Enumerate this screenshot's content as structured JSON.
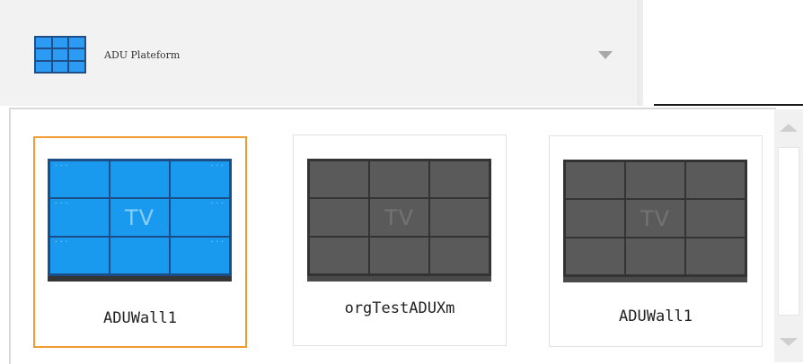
{
  "header": {
    "platform_label": "ADU Plateform",
    "platform_icon": "video-wall-grid-icon",
    "dropdown_icon": "chevron-down-icon"
  },
  "walls": [
    {
      "name": "ADUWall1",
      "screen_text": "TV",
      "selected": true,
      "status": "online"
    },
    {
      "name": "orgTestADUXm",
      "screen_text": "TV",
      "selected": false,
      "status": "offline"
    },
    {
      "name": "ADUWall1",
      "screen_text": "TV",
      "selected": false,
      "status": "offline"
    }
  ],
  "colors": {
    "selected_border": "#f39b33",
    "online_screen": "#1a9aee",
    "offline_screen": "#5a5a5a"
  }
}
